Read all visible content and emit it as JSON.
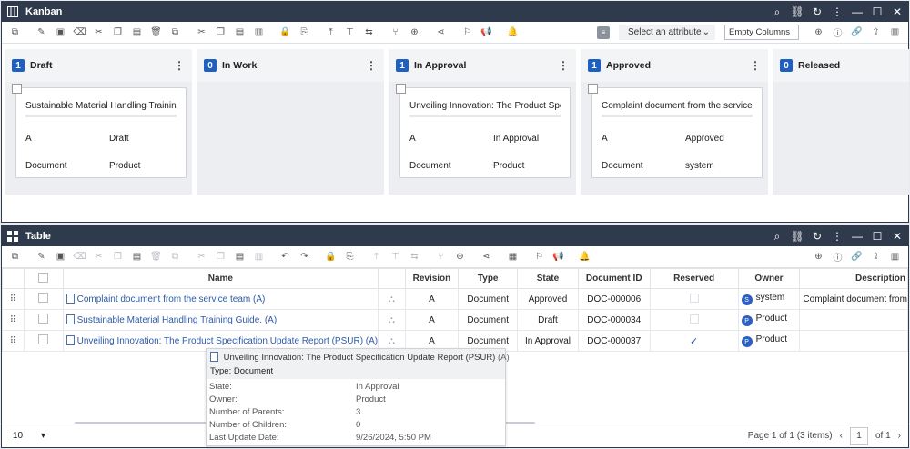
{
  "kanban": {
    "title": "Kanban",
    "select_attribute": "Select an attribute",
    "empty_columns": "Empty Columns",
    "columns": [
      {
        "count": "1",
        "name": "Draft",
        "card": {
          "title": "Sustainable Material Handling Training Gu",
          "rows": [
            [
              "A",
              "Draft"
            ],
            [
              "Document",
              "Product"
            ]
          ]
        }
      },
      {
        "count": "0",
        "name": "In Work"
      },
      {
        "count": "1",
        "name": "In Approval",
        "card": {
          "title": "Unveiling Innovation: The Product Specific",
          "rows": [
            [
              "A",
              "In Approval"
            ],
            [
              "Document",
              "Product"
            ]
          ]
        }
      },
      {
        "count": "1",
        "name": "Approved",
        "card": {
          "title": "Complaint document from the service tea",
          "rows": [
            [
              "A",
              "Approved"
            ],
            [
              "Document",
              "system"
            ]
          ]
        }
      },
      {
        "count": "0",
        "name": "Released"
      }
    ]
  },
  "table": {
    "title": "Table",
    "headers": {
      "name": "Name",
      "revision": "Revision",
      "type": "Type",
      "state": "State",
      "doc_id": "Document ID",
      "reserved": "Reserved",
      "owner": "Owner",
      "description": "Description"
    },
    "rows": [
      {
        "name": "Complaint document from the service team (A)",
        "revision": "A",
        "type": "Document",
        "state": "Approved",
        "doc_id": "DOC-000006",
        "reserved": false,
        "owner": "system",
        "owner_initial": "S",
        "description": "Complaint document from"
      },
      {
        "name": "Sustainable Material Handling Training Guide. (A)",
        "revision": "A",
        "type": "Document",
        "state": "Draft",
        "doc_id": "DOC-000034",
        "reserved": false,
        "owner": "Product",
        "owner_initial": "P",
        "description": ""
      },
      {
        "name": "Unveiling Innovation: The Product Specification Update Report (PSUR) (A)",
        "revision": "A",
        "type": "Document",
        "state": "In Approval",
        "doc_id": "DOC-000037",
        "reserved": true,
        "reserved_mark": "✓",
        "owner": "Product",
        "owner_initial": "P",
        "description": ""
      }
    ],
    "page_size": "10",
    "page_info": "Page 1 of 1 (3 items)",
    "page_current": "1",
    "page_of": "of 1"
  },
  "tooltip": {
    "title": "Unveiling Innovation: The Product Specification Update Report (PSUR)",
    "revision": "(A)",
    "type_line": "Type: Document",
    "fields": [
      [
        "State:",
        "In Approval"
      ],
      [
        "Owner:",
        "Product"
      ],
      [
        "Number of Parents:",
        "3"
      ],
      [
        "Number of Children:",
        "0"
      ],
      [
        "Last Update Date:",
        "9/26/2024, 5:50 PM"
      ]
    ]
  },
  "colors": {
    "titlebar": "#2f3a4c",
    "badge": "#1f5fbf",
    "link": "#2d5aa8"
  }
}
